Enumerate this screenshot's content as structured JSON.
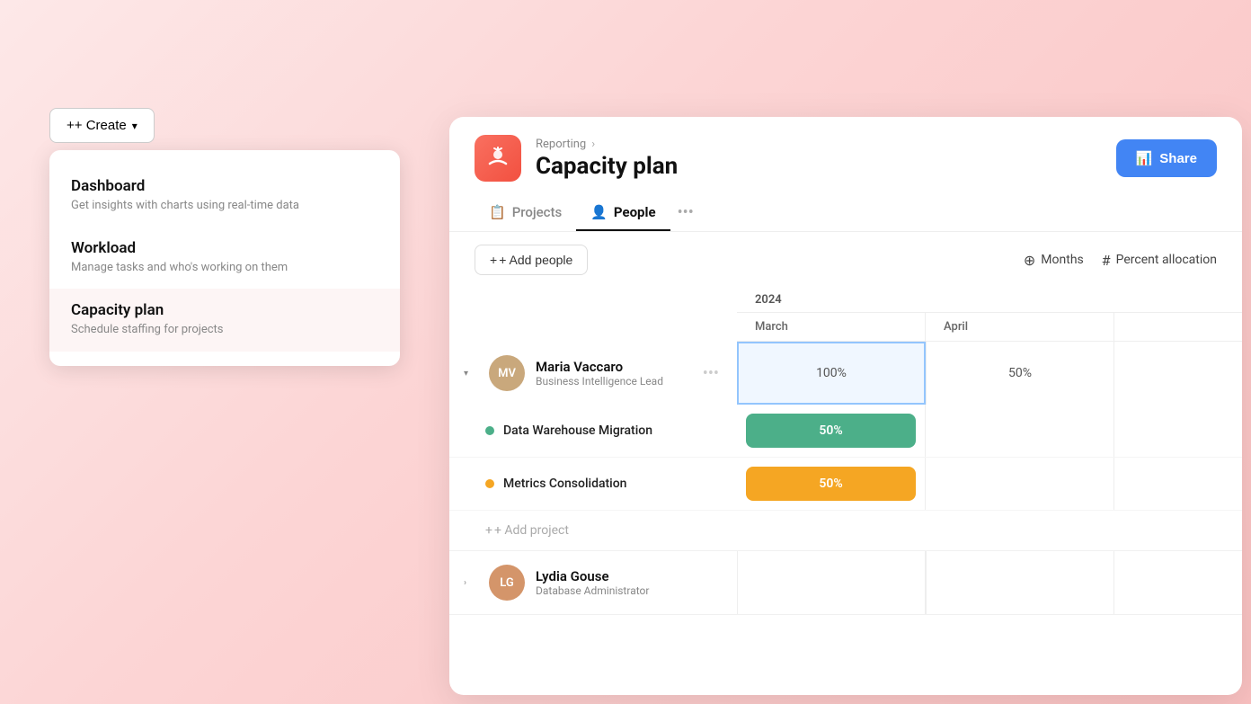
{
  "createButton": {
    "label": "+ Create",
    "chevron": "▾"
  },
  "menu": {
    "items": [
      {
        "id": "dashboard",
        "title": "Dashboard",
        "description": "Get insights with charts using real-time data"
      },
      {
        "id": "workload",
        "title": "Workload",
        "description": "Manage tasks and who's working on them"
      },
      {
        "id": "capacity-plan",
        "title": "Capacity plan",
        "description": "Schedule staffing for projects",
        "active": true
      }
    ]
  },
  "panel": {
    "breadcrumb": "Reporting",
    "breadcrumb_arrow": "›",
    "title": "Capacity plan",
    "share_label": "Share",
    "share_icon": "📊"
  },
  "tabs": [
    {
      "id": "projects",
      "label": "Projects",
      "icon": "📋",
      "active": false
    },
    {
      "id": "people",
      "label": "People",
      "icon": "👤",
      "active": true
    }
  ],
  "toolbar": {
    "add_people_label": "+ Add people",
    "months_label": "Months",
    "percent_label": "Percent allocation"
  },
  "calendar": {
    "year": "2024",
    "months": [
      "March",
      "April"
    ]
  },
  "people": [
    {
      "id": "maria",
      "name": "Maria Vaccaro",
      "role": "Business Intelligence Lead",
      "initials": "MV",
      "cells": [
        "100%",
        "50%"
      ],
      "projects": [
        {
          "name": "Data Warehouse Migration",
          "color": "#4caf89",
          "allocations": [
            "50%",
            null
          ]
        },
        {
          "name": "Metrics Consolidation",
          "color": "#f5a623",
          "allocations": [
            "50%",
            null
          ]
        }
      ]
    },
    {
      "id": "lydia",
      "name": "Lydia Gouse",
      "role": "Database Administrator",
      "initials": "LG",
      "cells": [
        "",
        ""
      ]
    }
  ],
  "add_project_label": "+ Add project",
  "icons": {
    "clock": "⊕",
    "hash": "#"
  }
}
